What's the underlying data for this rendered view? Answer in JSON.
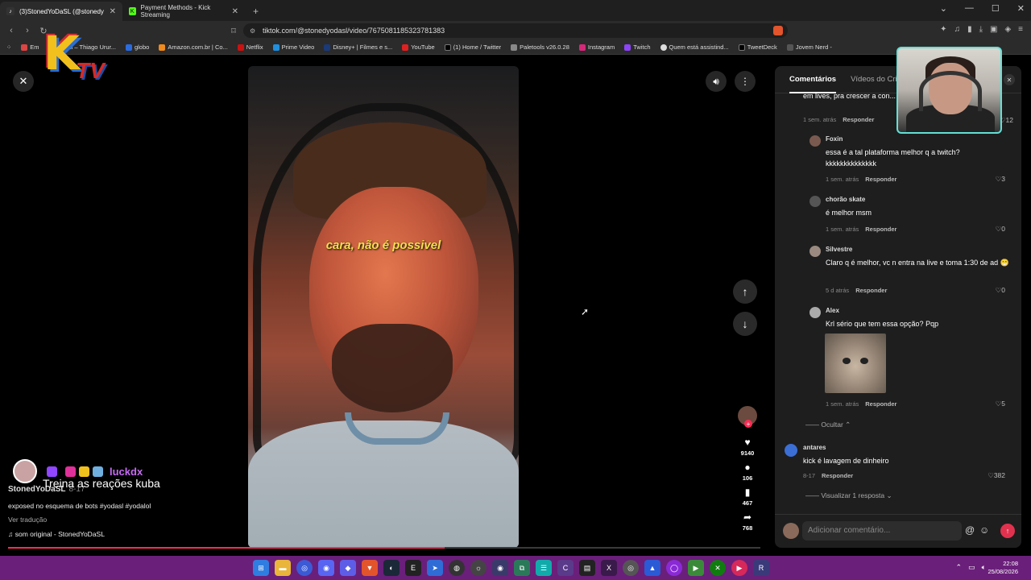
{
  "browser": {
    "tabs": [
      {
        "icon": "tiktok-icon",
        "label": "(3)StonedYoDaSL (@stonedy",
        "active": true
      },
      {
        "icon": "kick-icon",
        "label": "Payment Methods - Kick Streaming",
        "active": false
      }
    ],
    "new_tab": "+",
    "url": "tiktok.com/@stonedyodasl/video/7675081185323781383",
    "bookmarks": [
      "Em",
      "Email – Thiago Urur...",
      "globo",
      "Amazon.com.br | Co...",
      "Netflix",
      "Prime Video",
      "Disney+ | Filmes e s...",
      "YouTube",
      "(1) Home / Twitter",
      "Paletools v26.0.28",
      "Instagram",
      "Twitch",
      "Quem está assistind...",
      "TweetDeck",
      "Jovem Nerd -"
    ]
  },
  "video": {
    "caption": "cara, não é possivel",
    "likes": "9140",
    "comments": "106",
    "saves": "467",
    "shares": "768",
    "progress_fraction": 0.58
  },
  "overlay": {
    "chat_user": "luckdx",
    "chat_message": "Treina as reações kuba",
    "author": "StonedYoDaSL",
    "date": "8-17",
    "description": "exposed no esquema de bots #yodasl #yodalol",
    "translate": "Ver tradução",
    "sound": "som original - StonedYoDaSL"
  },
  "panel": {
    "tabs": [
      "Comentários",
      "Vídeos do Cri"
    ],
    "top_text": "em lives, pra crescer a con... la que vc ativa",
    "top_time": "1 sem. atrás",
    "top_likes": "12",
    "reply_label": "Responder",
    "comments": [
      {
        "name": "Foxin",
        "text": "essa é a tal plataforma melhor q a twitch? kkkkkkkkkkkkkk",
        "time": "1 sem. atrás",
        "likes": "3"
      },
      {
        "name": "chorão skate",
        "text": "é melhor msm",
        "time": "1 sem. atrás",
        "likes": "0"
      },
      {
        "name": "Silvestre",
        "text": "Claro q é melhor, vc n entra na live e toma 1:30 de ad 😁",
        "time": "5 d atrás",
        "likes": "0"
      },
      {
        "name": "Alex",
        "text": "Krl sério que tem essa opção? Pqp",
        "time": "1 sem. atrás",
        "likes": "5"
      },
      {
        "name": "antares",
        "text": "kick é lavagem de dinheiro",
        "time": "8-17",
        "likes": "382"
      }
    ],
    "hide_label": "Ocultar",
    "view_replies": "Visualizar 1 resposta",
    "input_placeholder": "Adicionar comentário..."
  },
  "taskbar": {
    "time": "22:08",
    "date": "25/08/2026"
  },
  "colors": {
    "accent": "#fe2c55",
    "taskbar": "#6a1f7a",
    "webcam_border": "#63e0d6"
  }
}
